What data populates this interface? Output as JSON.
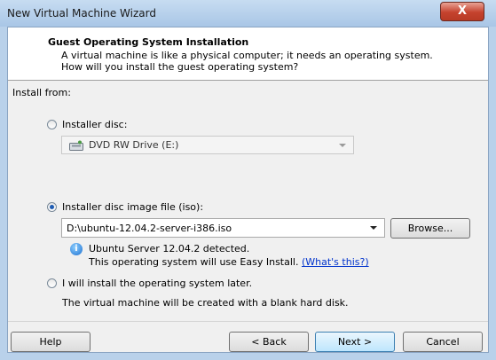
{
  "window": {
    "title": "New Virtual Machine Wizard",
    "close_glyph": "X"
  },
  "header": {
    "title": "Guest Operating System Installation",
    "description": "A virtual machine is like a physical computer; it needs an operating system. How will you install the guest operating system?"
  },
  "install_from_label": "Install from:",
  "options": {
    "installer_disc": {
      "label": "Installer disc:",
      "selected": false,
      "drive_value": "DVD RW Drive (E:)"
    },
    "iso": {
      "label": "Installer disc image file (iso):",
      "selected": true,
      "path": "D:\\ubuntu-12.04.2-server-i386.iso",
      "browse_label": "Browse...",
      "detected_line1": "Ubuntu Server 12.04.2 detected.",
      "detected_line2": "This operating system will use Easy Install.",
      "whats_this": "(What's this?)"
    },
    "later": {
      "label": "I will install the operating system later.",
      "selected": false,
      "description": "The virtual machine will be created with a blank hard disk."
    }
  },
  "buttons": {
    "help": "Help",
    "back": "< Back",
    "next": "Next >",
    "cancel": "Cancel"
  },
  "icons": {
    "info": "info-icon",
    "drive": "dvd-drive-icon",
    "close": "close-icon"
  },
  "colors": {
    "link": "#0033cc",
    "title_bar": "#b9d1ea",
    "close_button": "#c5422e"
  }
}
